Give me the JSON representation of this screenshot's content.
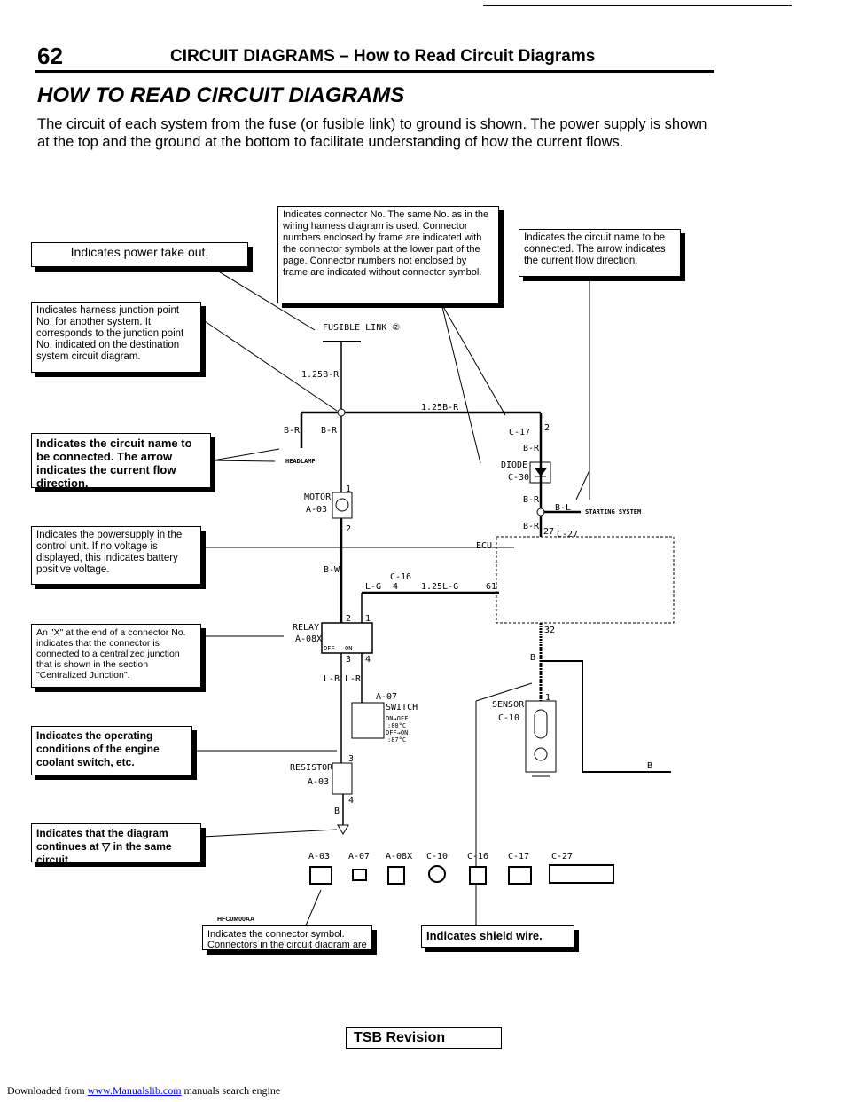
{
  "header": {
    "page_number": "62",
    "title": "CIRCUIT DIAGRAMS – How to Read Circuit Diagrams"
  },
  "heading": "HOW TO READ CIRCUIT DIAGRAMS",
  "intro": "The circuit of each system from the fuse (or fusible link) to ground is shown. The power supply is shown at the top and the ground at the bottom to facilitate understanding of how the current flows.",
  "callouts": {
    "power_take_out": "Indicates power take out.",
    "connector_no": "Indicates connector No. The same No. as in the wiring harness diagram is used. Connector numbers enclosed by frame are indicated with the connector symbols at the lower part of the page. Connector numbers not enclosed by frame are indicated without connector symbol.",
    "circuit_name_right": "Indicates the circuit name to be connected. The arrow indicates the current flow direction.",
    "junction_point": "Indicates harness junction point No. for another system. It corresponds to the junction point No. indicated on the destination system circuit diagram.",
    "circuit_name_left": "Indicates the circuit name to be connected. The arrow indicates the current flow direction.",
    "power_supply": "Indicates the powersupply in the control unit. If no voltage is displayed, this indicates battery positive voltage.",
    "x_connector": "An \"X\" at the end of a connector No. indicates that the connector is connected to a centralized junction that is shown in the section \"Centralized Junction\".",
    "operating_conditions": "Indicates the operating conditions of the engine coolant switch, etc.",
    "continues": "Indicates that the diagram continues at ▽ in the same circuit.",
    "connector_symbol": "Indicates the connector symbol. Connectors in the circuit diagram are indicated in numerical order.",
    "shield_wire": "Indicates shield wire."
  },
  "diagram": {
    "fusible_link": "FUSIBLE LINK ②",
    "wire_125br_v": "1.25B-R",
    "wire_125br_h": "1.25B-R",
    "br1": "B-R",
    "br2": "B-R",
    "headlamp": "HEADLAMP",
    "c17": "C-17",
    "pin2": "2",
    "br3": "B-R",
    "diode": "DIODE",
    "c30": "C-30",
    "br4": "B-R",
    "bl": "B-L",
    "starting_system": "STARTING SYSTEM",
    "br5": "B-R",
    "pin27": "27",
    "c27": "C-27",
    "motor": "MOTOR",
    "a03m": "A-03",
    "m1": "1",
    "m2": "2",
    "bw": "B-W",
    "ecu": "ECU",
    "c16": "C-16",
    "lg": "L-G",
    "pin4": "4",
    "wire_125lg": "1.25L-G",
    "pin61": "61",
    "relay": "RELAY",
    "a08x": "A-08X",
    "r2": "2",
    "r1": "1",
    "r3": "3",
    "r4": "4",
    "off": "OFF",
    "on": "ON",
    "lb": "L-B",
    "lr": "L-R",
    "a07": "A-07",
    "switch": "SWITCH",
    "cond1": "ON→OFF",
    "cond1t": ":80°C",
    "cond2": "OFF→ON",
    "cond2t": ":87°C",
    "resistor": "RESISTOR",
    "a03r": "A-03",
    "res3": "3",
    "res4": "4",
    "b1": "B",
    "pin32": "32",
    "b2": "B",
    "sensor": "SENSOR",
    "c10": "C-10",
    "s1": "1",
    "b3": "B",
    "connectors": [
      "A-03",
      "A-07",
      "A-08X",
      "C-10",
      "C-16",
      "C-17",
      "C-27"
    ],
    "code": "HFC0M00AA"
  },
  "tsb": "TSB Revision",
  "footer": {
    "prefix": "Downloaded from ",
    "link": "www.Manualslib.com",
    "suffix": " manuals search engine"
  }
}
